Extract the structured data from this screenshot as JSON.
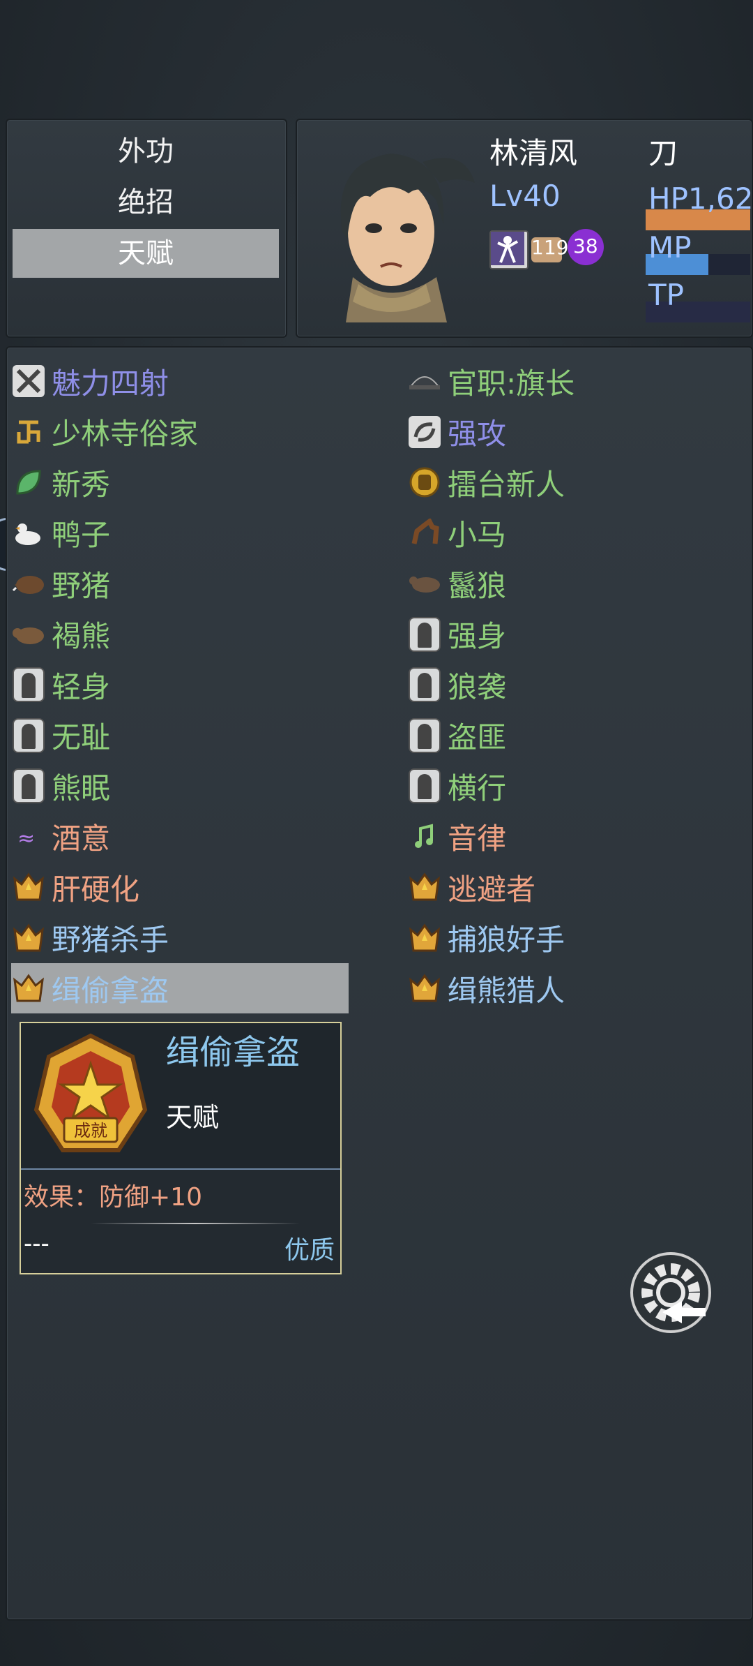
{
  "menu": {
    "items": [
      "外功",
      "绝招",
      "天赋"
    ],
    "selected_index": 2
  },
  "character": {
    "name": "林清风",
    "weapon": "刀",
    "level": "Lv40",
    "hp_label": "HP1,62",
    "mp_label": "MP",
    "tp_label": "TP",
    "hp_fill": 1.0,
    "mp_fill": 0.6,
    "tp_fill": 0.0,
    "state_count_1": "119",
    "state_count_2": "38"
  },
  "skills_left": [
    {
      "label": "魅力四射",
      "icon": "sparkle-icon",
      "color": "#8f8fe8"
    },
    {
      "label": "少林寺俗家",
      "icon": "swastika-icon",
      "color": "#8fcf7a"
    },
    {
      "label": "新秀",
      "icon": "leaf-icon",
      "color": "#8fcf7a"
    },
    {
      "label": "鸭子",
      "icon": "duck-icon",
      "color": "#8fcf7a"
    },
    {
      "label": "野猪",
      "icon": "boar-icon",
      "color": "#8fcf7a"
    },
    {
      "label": "褐熊",
      "icon": "bear-icon",
      "color": "#8fcf7a"
    },
    {
      "label": "轻身",
      "icon": "silhouette-icon",
      "color": "#8fcf7a"
    },
    {
      "label": "无耻",
      "icon": "silhouette-icon",
      "color": "#8fcf7a"
    },
    {
      "label": "熊眠",
      "icon": "silhouette-icon",
      "color": "#8fcf7a"
    },
    {
      "label": "酒意",
      "icon": "wine-icon",
      "color": "#f0a283"
    },
    {
      "label": "肝硬化",
      "icon": "crown-icon",
      "color": "#f0a283"
    },
    {
      "label": "野猪杀手",
      "icon": "crown-icon",
      "color": "#9ec8f0"
    },
    {
      "label": "缉偷拿盗",
      "icon": "crown-icon",
      "color": "#9ec8f0"
    }
  ],
  "skills_right": [
    {
      "label": "官职:旗长",
      "icon": "official-hat-icon",
      "color": "#8fcf7a"
    },
    {
      "label": "强攻",
      "icon": "swirl-icon",
      "color": "#8f8fe8"
    },
    {
      "label": "擂台新人",
      "icon": "fist-icon",
      "color": "#8fcf7a"
    },
    {
      "label": "小马",
      "icon": "horse-icon",
      "color": "#8fcf7a"
    },
    {
      "label": "鬣狼",
      "icon": "hyena-icon",
      "color": "#8fcf7a"
    },
    {
      "label": "强身",
      "icon": "silhouette-icon",
      "color": "#8fcf7a"
    },
    {
      "label": "狼袭",
      "icon": "silhouette-icon",
      "color": "#8fcf7a"
    },
    {
      "label": "盗匪",
      "icon": "silhouette-icon",
      "color": "#8fcf7a"
    },
    {
      "label": "横行",
      "icon": "silhouette-icon",
      "color": "#8fcf7a"
    },
    {
      "label": "音律",
      "icon": "music-icon",
      "color": "#f0a283"
    },
    {
      "label": "逃避者",
      "icon": "crown-icon",
      "color": "#f0a283"
    },
    {
      "label": "捕狼好手",
      "icon": "crown-icon",
      "color": "#9ec8f0"
    },
    {
      "label": "缉熊猎人",
      "icon": "crown-icon",
      "color": "#9ec8f0"
    }
  ],
  "selected_skill": "left-12",
  "detail": {
    "title": "缉偷拿盗",
    "category": "天赋",
    "effect": "效果：防御+10",
    "note": "---",
    "quality": "优质",
    "badge_text": "成就"
  },
  "colors": {
    "hp": "#d8884a",
    "mp": "#4d8fd6",
    "tp": "#272b45"
  }
}
